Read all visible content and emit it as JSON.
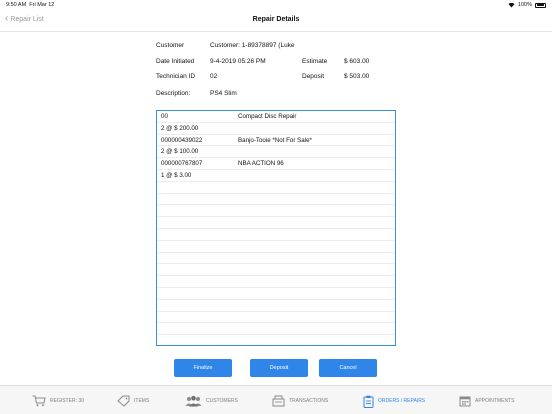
{
  "status_bar": {
    "time": "9:50 AM",
    "date": "Fri Mar 12",
    "battery": "100%"
  },
  "nav": {
    "back_label": "Repair List",
    "title": "Repair Details"
  },
  "details": {
    "customer_label": "Customer",
    "customer_value": "Customer: 1-89378897 (Luke",
    "date_label": "Date Initiated",
    "date_value": "9-4-2019 05:26 PM",
    "estimate_label": "Estimate",
    "estimate_value": "$ 603.00",
    "technician_label": "Technician ID",
    "technician_value": "02",
    "deposit_label": "Deposit",
    "deposit_value": "$ 503.00",
    "description_label": "Description:",
    "description_value": "PS4 Slim"
  },
  "items": [
    {
      "sku": "00",
      "name": "Compact Disc Repair",
      "qty_price": "2 @ $ 200.00"
    },
    {
      "sku": "000000439022",
      "name": "Banjo-Tooie *Not For Sale*",
      "qty_price": "2 @ $ 100.00"
    },
    {
      "sku": "000000767807",
      "name": "NBA ACTION 96",
      "qty_price": "1 @ $ 3.00"
    }
  ],
  "buttons": {
    "finalize": "Finalize",
    "deposit": "Deposit",
    "cancel": "Cancel"
  },
  "tabs": [
    {
      "label": "REGISTER: 30",
      "icon": "cart-icon"
    },
    {
      "label": "ITEMS",
      "icon": "tag-icon"
    },
    {
      "label": "CUSTOMERS",
      "icon": "people-icon"
    },
    {
      "label": "TRANSACTIONS",
      "icon": "register-icon"
    },
    {
      "label": "ORDERS / REPAIRS",
      "icon": "clipboard-icon",
      "active": true
    },
    {
      "label": "APPOINTMENTS",
      "icon": "calendar-icon"
    }
  ],
  "colors": {
    "accent": "#2f86e8",
    "list_border": "#3b8fe0",
    "inactive_tab": "#7d7d7d"
  }
}
